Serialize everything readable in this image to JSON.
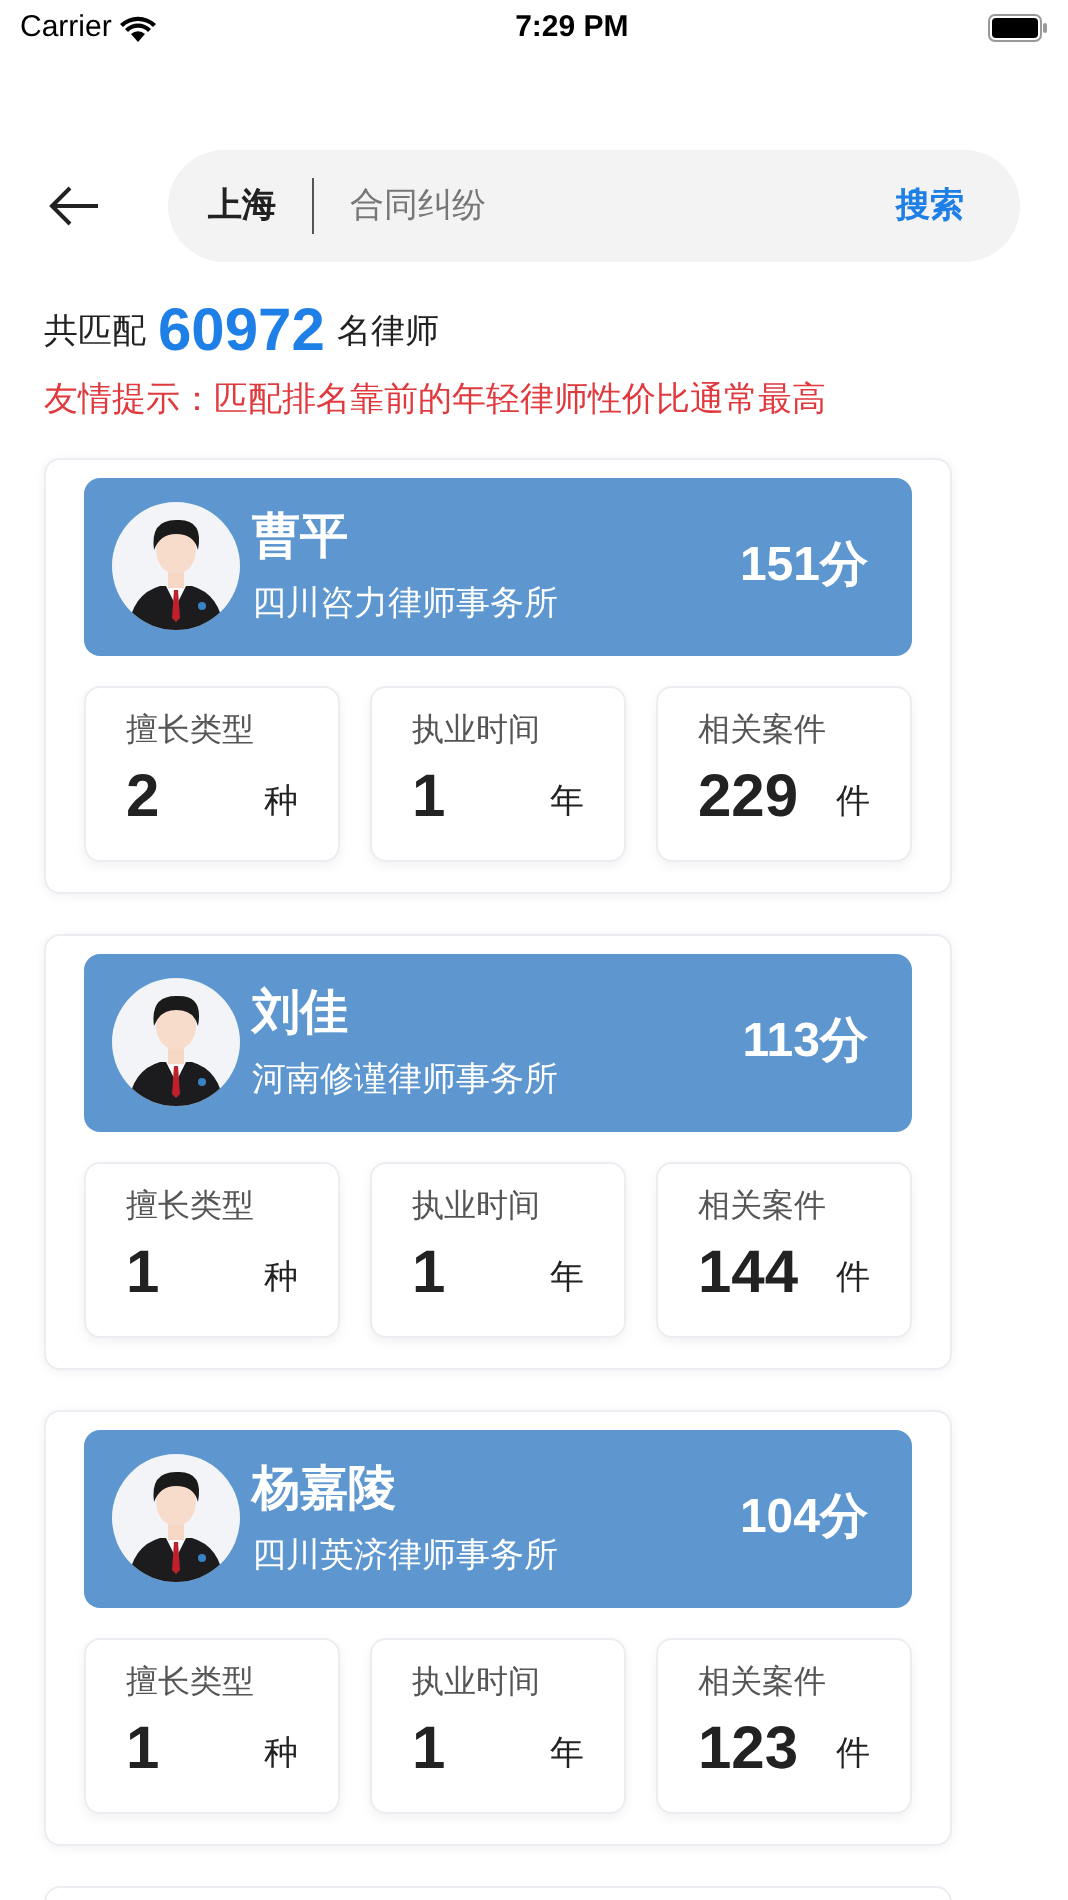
{
  "status_bar": {
    "carrier": "Carrier",
    "time": "7:29 PM"
  },
  "search": {
    "city": "上海",
    "value": "合同纠纷",
    "button": "搜索"
  },
  "summary": {
    "prefix": "共匹配",
    "count": "60972",
    "suffix": "名律师"
  },
  "tip": "友情提示：匹配排名靠前的年轻律师性价比通常最高",
  "lawyers": [
    {
      "name": "曹平",
      "firm": "四川咨力律师事务所",
      "score": "151分",
      "stats": [
        {
          "label": "擅长类型",
          "value": "2",
          "unit": "种"
        },
        {
          "label": "执业时间",
          "value": "1",
          "unit": "年"
        },
        {
          "label": "相关案件",
          "value": "229",
          "unit": "件"
        }
      ]
    },
    {
      "name": "刘佳",
      "firm": "河南修谨律师事务所",
      "score": "113分",
      "stats": [
        {
          "label": "擅长类型",
          "value": "1",
          "unit": "种"
        },
        {
          "label": "执业时间",
          "value": "1",
          "unit": "年"
        },
        {
          "label": "相关案件",
          "value": "144",
          "unit": "件"
        }
      ]
    },
    {
      "name": "杨嘉陵",
      "firm": "四川英济律师事务所",
      "score": "104分",
      "stats": [
        {
          "label": "擅长类型",
          "value": "1",
          "unit": "种"
        },
        {
          "label": "执业时间",
          "value": "1",
          "unit": "年"
        },
        {
          "label": "相关案件",
          "value": "123",
          "unit": "件"
        }
      ]
    }
  ]
}
